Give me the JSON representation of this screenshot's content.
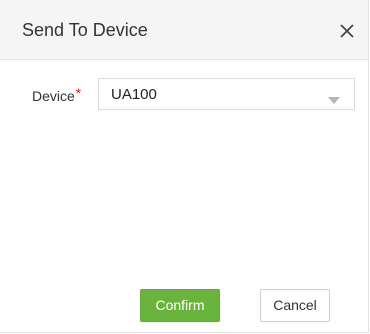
{
  "dialog": {
    "title": "Send To Device",
    "close_icon": "close-icon"
  },
  "form": {
    "device_label": "Device",
    "required_mark": "*",
    "device_value": "UA100",
    "dropdown_icon": "chevron-down-icon"
  },
  "buttons": {
    "confirm_label": "Confirm",
    "cancel_label": "Cancel"
  },
  "colors": {
    "header_bg": "#f5f5f5",
    "confirm_bg": "#6ab33c",
    "required": "#e02020"
  }
}
